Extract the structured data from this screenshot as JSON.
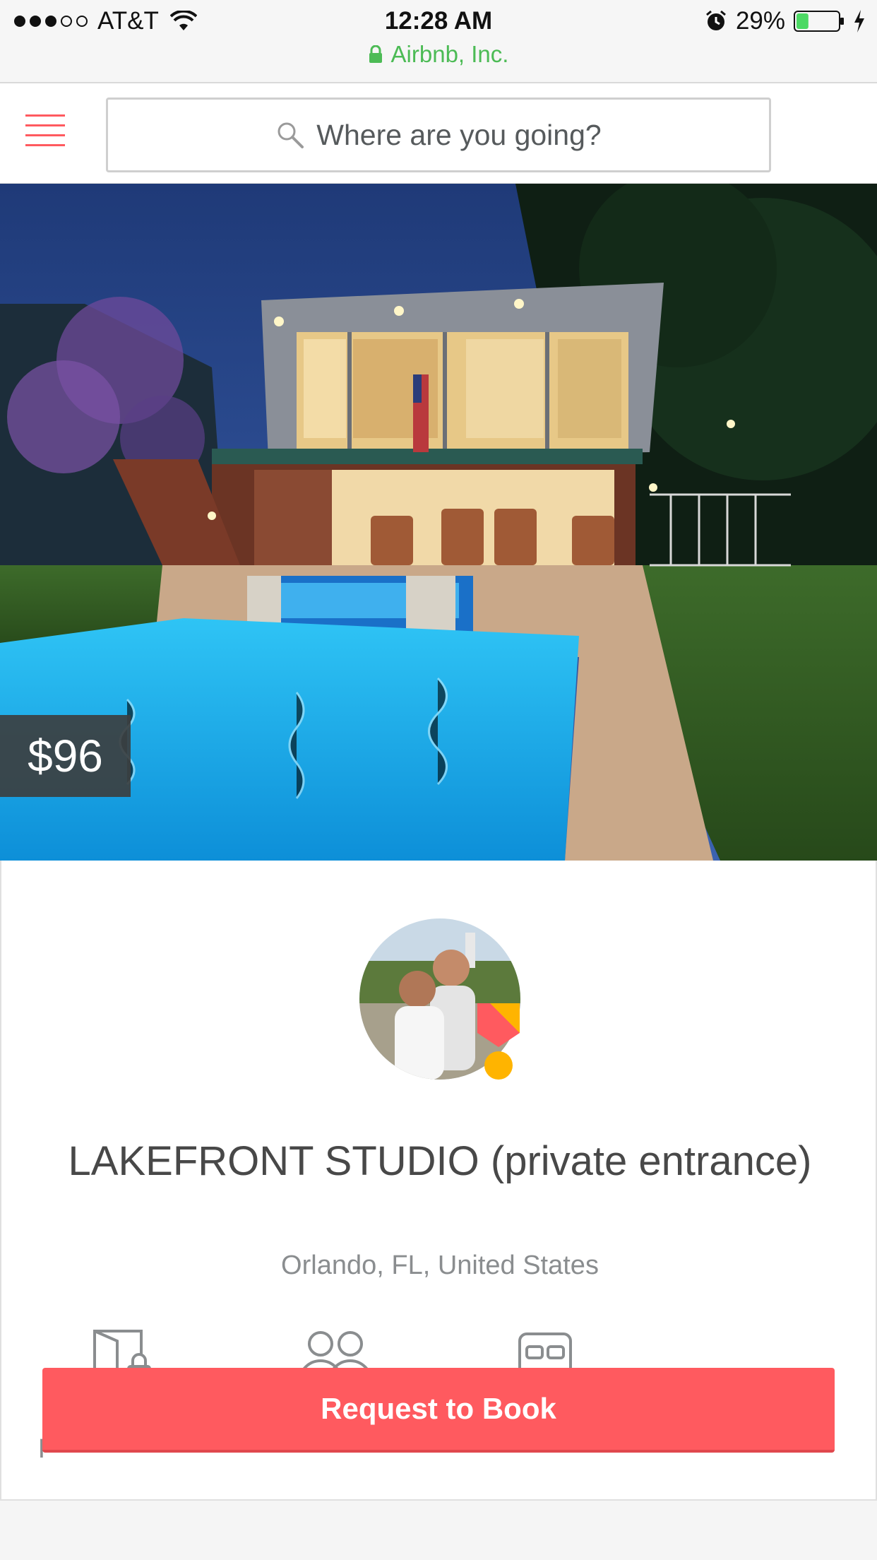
{
  "status_bar": {
    "carrier": "AT&T",
    "time": "12:28 AM",
    "battery": "29%",
    "battery_level": 0.29,
    "signal_bars_filled": 3,
    "signal_bars_total": 5,
    "site_name": "Airbnb, Inc.",
    "site_color": "#4cbb55"
  },
  "header": {
    "menu_icon": "hamburger-icon",
    "search_placeholder": "Where are you going?",
    "search_icon": "search-icon"
  },
  "listing": {
    "price": "$96",
    "title": "LAKEFRONT STUDIO (private entrance)",
    "location": "Orlando, FL, United States",
    "host_badge": "superhost-badge-icon",
    "amenity_icons": [
      "private-room-icon",
      "guests-icon",
      "bed-icon"
    ],
    "partial_label": "P"
  },
  "actions": {
    "request_to_book": "Request to Book"
  },
  "colors": {
    "brand": "#ff5a5f",
    "text": "#484848",
    "muted": "#8a8d8f"
  }
}
